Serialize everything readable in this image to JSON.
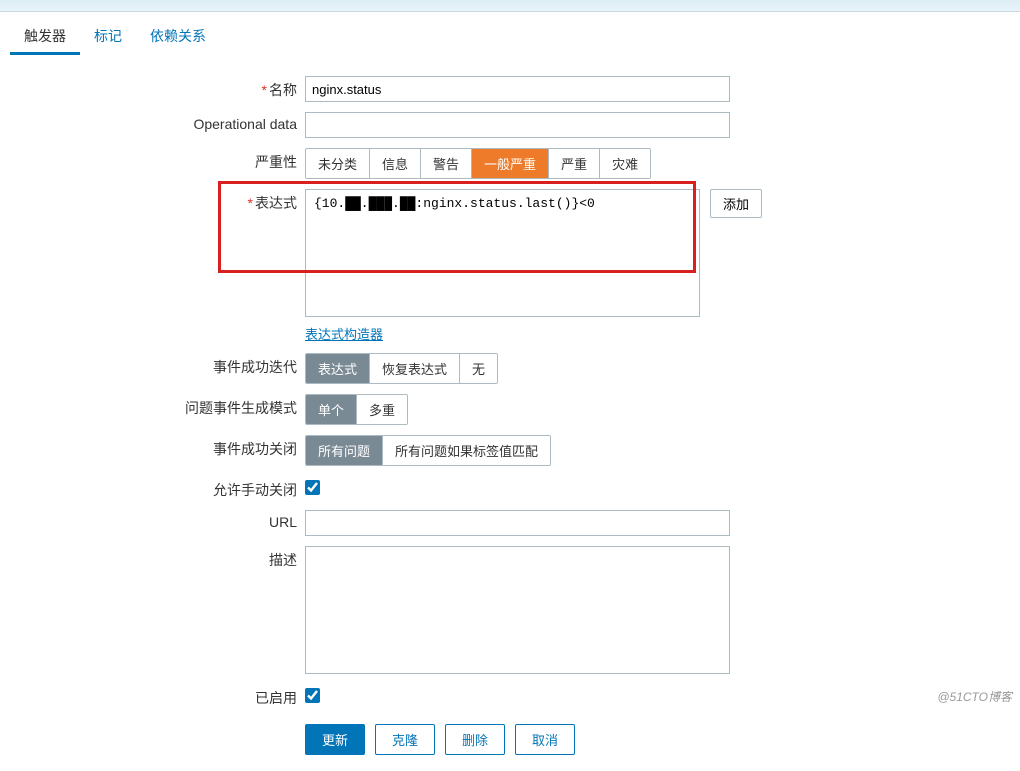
{
  "tabs": {
    "trigger": "触发器",
    "tags": "标记",
    "deps": "依赖关系"
  },
  "labels": {
    "name": "名称",
    "opdata": "Operational data",
    "severity": "严重性",
    "expr": "表达式",
    "expr_builder": "表达式构造器",
    "ok_event": "事件成功迭代",
    "problem_mode": "问题事件生成模式",
    "ok_close": "事件成功关闭",
    "manual_close": "允许手动关闭",
    "url": "URL",
    "desc": "描述",
    "enabled": "已启用"
  },
  "values": {
    "name": "nginx.status",
    "opdata": "",
    "expr_prefix": "{10.",
    "expr_redacted": "██.███.██:n",
    "expr_suffix": "ginx.status.last()}<0",
    "url": "",
    "desc": "",
    "manual_close": true,
    "enabled": true
  },
  "severity": {
    "options": [
      "未分类",
      "信息",
      "警告",
      "一般严重",
      "严重",
      "灾难"
    ],
    "selected": "一般严重"
  },
  "ok_event": {
    "options": [
      "表达式",
      "恢复表达式",
      "无"
    ],
    "selected": "表达式"
  },
  "problem_mode": {
    "options": [
      "单个",
      "多重"
    ],
    "selected": "单个"
  },
  "ok_close": {
    "options": [
      "所有问题",
      "所有问题如果标签值匹配"
    ],
    "selected": "所有问题"
  },
  "buttons": {
    "add": "添加",
    "update": "更新",
    "clone": "克隆",
    "delete": "删除",
    "cancel": "取消"
  },
  "watermark": "@51CTO博客"
}
